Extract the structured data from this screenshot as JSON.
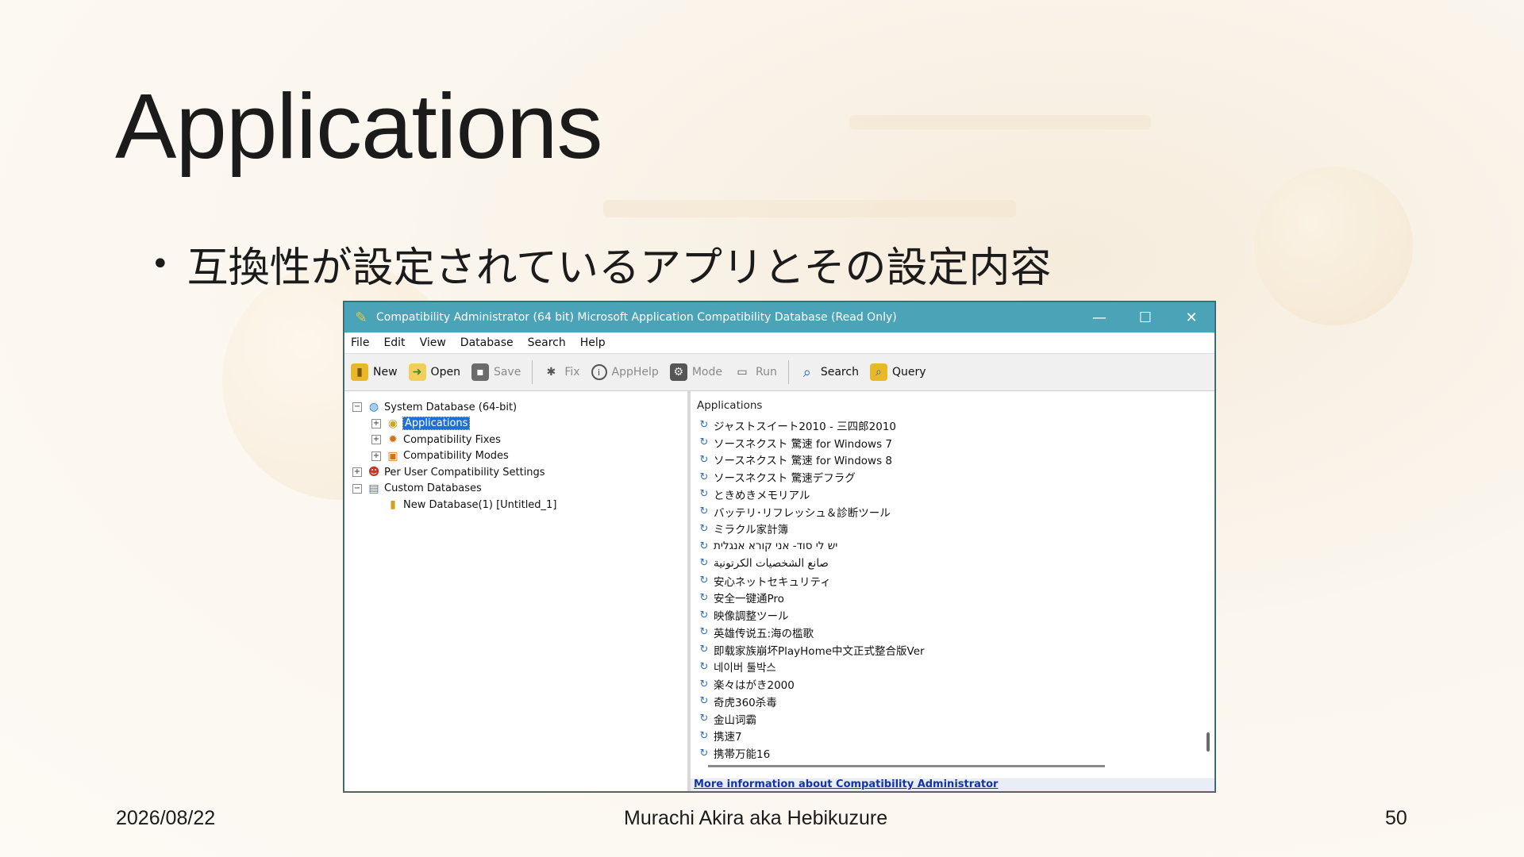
{
  "slide": {
    "title": "Applications",
    "bullet": "互換性が設定されているアプリとその設定内容",
    "footer_date": "2026/08/22",
    "footer_author": "Murachi Akira aka Hebikuzure",
    "page_number": "50"
  },
  "window": {
    "title": "Compatibility Administrator (64 bit)  Microsoft Application Compatibility Database (Read Only)",
    "controls": {
      "minimize": "—",
      "maximize": "☐",
      "close": "✕"
    },
    "menu": [
      "File",
      "Edit",
      "View",
      "Database",
      "Search",
      "Help"
    ],
    "toolbar": {
      "new": "New",
      "open": "Open",
      "save": "Save",
      "fix": "Fix",
      "apphelp": "AppHelp",
      "mode": "Mode",
      "run": "Run",
      "search": "Search",
      "query": "Query"
    },
    "tree": {
      "system_db": "System Database (64-bit)",
      "applications": "Applications",
      "compat_fixes": "Compatibility Fixes",
      "compat_modes": "Compatibility Modes",
      "per_user": "Per User Compatibility Settings",
      "custom_dbs": "Custom Databases",
      "new_db": "New Database(1) [Untitled_1]"
    },
    "right_header": "Applications",
    "applications": [
      "ジャストスイート2010 - 三四郎2010",
      "ソースネクスト 驚速 for Windows 7",
      "ソースネクスト 驚速 for Windows 8",
      "ソースネクスト 驚速デフラグ",
      "ときめきメモリアル",
      "バッテリ･リフレッシュ＆診断ツール",
      "ミラクル家計簿",
      "יש לי סוד- אני קורא אנגלית",
      "صانع الشخصيات الكرتونية",
      "安心ネットセキュリティ",
      "安全一键通Pro",
      "映像調整ツール",
      "英雄传说五:海の槛歌",
      "即载家族崩坏PlayHome中文正式整合版Ver",
      "네이버 툴박스",
      "楽々はがき2000",
      "奇虎360杀毒",
      "金山词霸",
      "携速7",
      "携帯万能16"
    ],
    "more_info": "More information about Compatibility Administrator"
  }
}
